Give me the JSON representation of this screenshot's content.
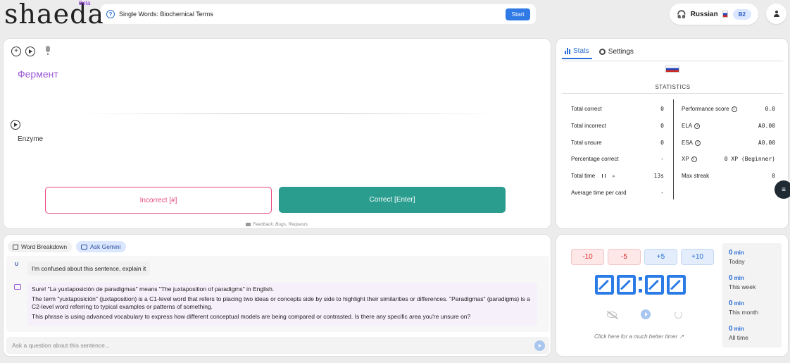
{
  "app": {
    "logo": "shaeda",
    "beta_label": "Beta"
  },
  "topbar": {
    "topic": "Single Words: Biochemical Terms",
    "start_label": "Start"
  },
  "language": {
    "name": "Russian",
    "level": "B2"
  },
  "flashcard": {
    "word": "Фермент",
    "translation": "Enzyme",
    "incorrect_label": "Incorrect [#]",
    "correct_label": "Correct [Enter]",
    "feedback_label": "Feedback, Bugs, Requests"
  },
  "stats": {
    "tabs": [
      {
        "label": "Stats"
      },
      {
        "label": "Settings"
      }
    ],
    "title": "STATISTICS",
    "left": [
      {
        "label": "Total correct",
        "value": "0"
      },
      {
        "label": "Total incorrect",
        "value": "0"
      },
      {
        "label": "Total unsure",
        "value": "0"
      },
      {
        "label": "Percentage correct",
        "value": "-"
      },
      {
        "label": "Total time",
        "value": "13s"
      },
      {
        "label": "Average time per card",
        "value": "-"
      }
    ],
    "right": [
      {
        "label": "Performance score",
        "value": "0.0"
      },
      {
        "label": "ELA",
        "value": "A0.00"
      },
      {
        "label": "ESA",
        "value": "A0.00"
      },
      {
        "label": "XP",
        "value": "0 XP (Beginner)"
      },
      {
        "label": "Max streak",
        "value": "0"
      }
    ]
  },
  "chat": {
    "tabs": [
      {
        "label": "Word Breakdown"
      },
      {
        "label": "Ask Gemini"
      }
    ],
    "user_avatar": "U",
    "user_message": "I'm confused about this sentence, explain it",
    "bot_paragraphs": [
      "Sure! \"La yuxtaposición de paradigmas\" means \"The juxtaposition of paradigms\" in English.",
      "The term \"yuxtaposición\" (juxtaposition) is a C1-level word that refers to placing two ideas or concepts side by side to highlight their similarities or differences. \"Paradigmas\" (paradigms) is a C2-level word referring to typical examples or patterns of something.",
      "This phrase is using advanced vocabulary to express how different conceptual models are being compared or contrasted. Is there any specific area you're unsure on?"
    ],
    "input_placeholder": "Ask a question about this sentence..."
  },
  "timer": {
    "buttons": [
      {
        "label": "-10"
      },
      {
        "label": "-5"
      },
      {
        "label": "+5"
      },
      {
        "label": "+10"
      }
    ],
    "display": "00:00",
    "link_label": "Click here for a much better timer",
    "summary": [
      {
        "value": "0",
        "unit": "min",
        "label": "Today"
      },
      {
        "value": "0",
        "unit": "min",
        "label": "This week"
      },
      {
        "value": "0",
        "unit": "min",
        "label": "This month"
      },
      {
        "value": "0",
        "unit": "min",
        "label": "All time"
      }
    ]
  }
}
